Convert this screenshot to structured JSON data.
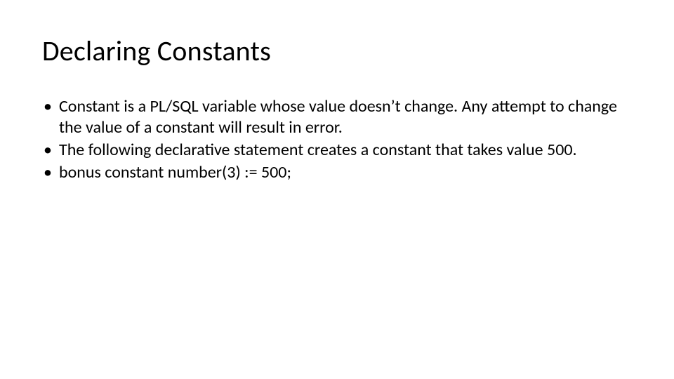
{
  "slide": {
    "title": "Declaring Constants",
    "bullets": [
      "Constant is a PL/SQL variable whose value doesn’t change. Any attempt to change the value of a constant will result in error.",
      "The following declarative statement creates a constant that takes value 500.",
      "bonus constant  number(3) :=  500;"
    ]
  }
}
